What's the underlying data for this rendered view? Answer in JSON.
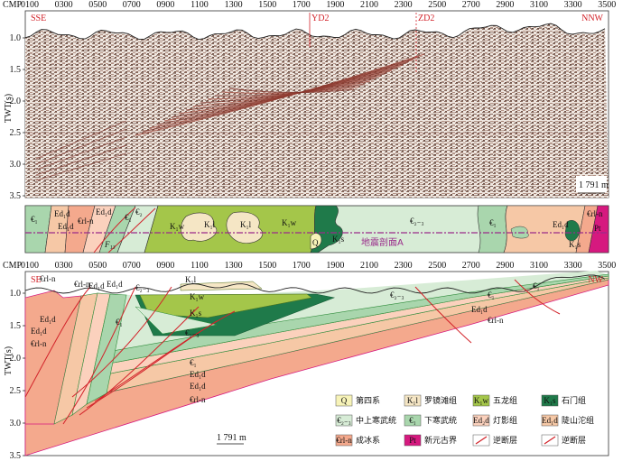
{
  "axes": {
    "cmp_label": "CMP",
    "cmp_ticks": [
      "0100",
      "0300",
      "0500",
      "0700",
      "0900",
      "1100",
      "1300",
      "1500",
      "1700",
      "1900",
      "2100",
      "2300",
      "2500",
      "2700",
      "2900",
      "3100",
      "3300",
      "3500"
    ],
    "twt_label": "TWT(s)",
    "seismic_twt_ticks": [
      "1.0",
      "1.5",
      "2.0",
      "2.5",
      "3.0",
      "3.5"
    ],
    "section_twt_ticks": [
      "1.0",
      "1.5",
      "2.0",
      "2.5",
      "3.0",
      "3.5"
    ]
  },
  "seismic": {
    "dir_left": "SSE",
    "dir_right": "NNW",
    "well1": "YD2",
    "well2": "ZD2",
    "scale": "1 791 m"
  },
  "plan": {
    "labels": [
      "€₁",
      "Ed₁d",
      "Ed₁d",
      "Ed₁d",
      "€rl-n",
      "€₁",
      "€₂",
      "K₁w",
      "K₁l",
      "K₁l",
      "K₁w",
      "Q",
      "K₁s",
      "€₂₋₃",
      "€₁",
      "Ed₁d",
      "K₁s",
      "€rl-n",
      "Pt"
    ],
    "fault_label": "F₁₃",
    "line_label": "地震剖面A"
  },
  "section": {
    "dir_left": "SE",
    "dir_right": "NW",
    "scale": "1 791 m",
    "labels": [
      "€rl-n",
      "€rl-n",
      "Ed₁d",
      "Ed₁d",
      "€₂₋₃",
      "K₁l",
      "K₁w",
      "€₁",
      "K₁s",
      "€₂₋₃",
      "€₁",
      "Ed₁d",
      "Ed₁d",
      "€rl-n",
      "Ed₁d",
      "Ed₁d",
      "€rl-n",
      "€₂₋₃",
      "€₁",
      "€₁",
      "Ed₁d",
      "€rl-n"
    ]
  },
  "legend": [
    {
      "sym": "Q",
      "name": "第四系",
      "color": "#f7f3b8"
    },
    {
      "sym": "K₁l",
      "name": "罗镜滩组",
      "color": "#f5e6c5"
    },
    {
      "sym": "K₁w",
      "name": "五龙组",
      "color": "#a4c64a"
    },
    {
      "sym": "K₁s",
      "name": "石门组",
      "color": "#1f7a4a"
    },
    {
      "sym": "€₂₋₃",
      "name": "中上寒武统",
      "color": "#d7ecd6"
    },
    {
      "sym": "€₁",
      "name": "下寒武统",
      "color": "#a9d6ad"
    },
    {
      "sym": "Ed₂d",
      "name": "灯影组",
      "color": "#fbd1bd"
    },
    {
      "sym": "Ed₁d",
      "name": "陡山沱组",
      "color": "#f6c8a6"
    },
    {
      "sym": "€rl-n",
      "name": "成冰系",
      "color": "#f4a98d"
    },
    {
      "sym": "Pt",
      "name": "新元古界",
      "color": "#d6197f"
    },
    {
      "sym": "",
      "name": "逆断层",
      "color": "#d2232a"
    },
    {
      "sym": "",
      "name": "逆断层",
      "color": "#d2232a"
    }
  ],
  "colors": {
    "K1s": "#1f7a4a",
    "K1w": "#a4c64a",
    "K1l": "#f5e6c5",
    "C23": "#d7ecd6",
    "C1": "#a9d6ad",
    "Ed2": "#fbd1bd",
    "Ed1": "#f6c8a6",
    "Crl": "#f4a98d",
    "Pt": "#d6197f",
    "Q": "#f7f3b8",
    "fault": "#d2232a",
    "line": "#9a2b8a"
  }
}
